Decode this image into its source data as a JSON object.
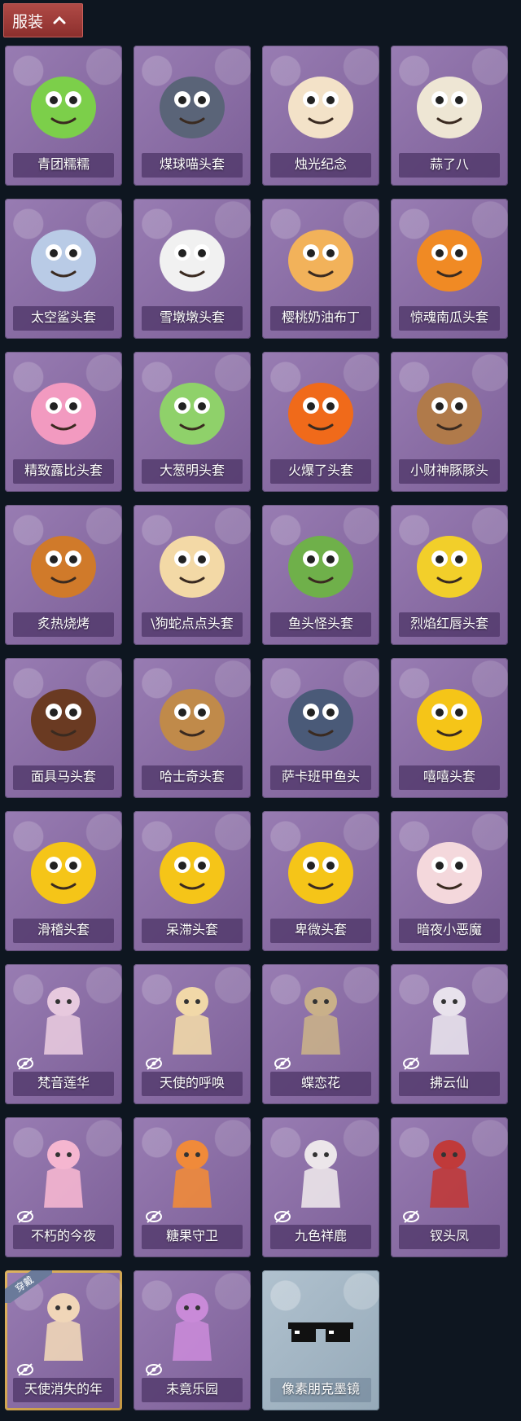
{
  "header": {
    "title": "服装"
  },
  "costumes": [
    {
      "label": "青团糯糯",
      "art": "green-mochi-head",
      "color": "#7ccf4a",
      "hidden": false
    },
    {
      "label": "煤球喵头套",
      "art": "gray-cat-head",
      "color": "#5a6478",
      "hidden": false
    },
    {
      "label": "烛光纪念",
      "art": "candle-head",
      "color": "#f3e2c8",
      "hidden": false
    },
    {
      "label": "蒜了八",
      "art": "garlic-head",
      "color": "#eee6d4",
      "hidden": false
    },
    {
      "label": "太空鲨头套",
      "art": "shark-head",
      "color": "#b9cbe6",
      "hidden": false
    },
    {
      "label": "雪墩墩头套",
      "art": "snowman-head",
      "color": "#f1f1f1",
      "hidden": false
    },
    {
      "label": "樱桃奶油布丁",
      "art": "pudding-head",
      "color": "#f2b25a",
      "hidden": false
    },
    {
      "label": "惊魂南瓜头套",
      "art": "pumpkin-head",
      "color": "#f08a24",
      "hidden": false
    },
    {
      "label": "精致露比头套",
      "art": "pink-beaver-head",
      "color": "#f29ac0",
      "hidden": false
    },
    {
      "label": "大葱明头套",
      "art": "scallion-head",
      "color": "#8fd16a",
      "hidden": false
    },
    {
      "label": "火爆了头套",
      "art": "fire-head",
      "color": "#f06a1a",
      "hidden": false
    },
    {
      "label": "小财神豚豚头",
      "art": "capybara-head",
      "color": "#b07a4a",
      "hidden": false
    },
    {
      "label": "炙热烧烤",
      "art": "bbq-head",
      "color": "#d07a2a",
      "hidden": false
    },
    {
      "label": "\\狗蛇点点头套",
      "art": "snake-dog-head",
      "color": "#f3d9a6",
      "hidden": false
    },
    {
      "label": "鱼头怪头套",
      "art": "fish-head",
      "color": "#6fb04a",
      "hidden": false
    },
    {
      "label": "烈焰红唇头套",
      "art": "pikachu-head",
      "color": "#f2cf2a",
      "hidden": false
    },
    {
      "label": "面具马头套",
      "art": "horse-head",
      "color": "#6a3a22",
      "hidden": false
    },
    {
      "label": "哈士奇头套",
      "art": "dog-sunglasses-head",
      "color": "#c08a4a",
      "hidden": false
    },
    {
      "label": "萨卡班甲鱼头",
      "art": "round-fish-head",
      "color": "#4a5a78",
      "hidden": false
    },
    {
      "label": "嘻嘻头套",
      "art": "grin-emoji-head",
      "color": "#f5c518",
      "hidden": false
    },
    {
      "label": "滑稽头套",
      "art": "smirk-emoji-head",
      "color": "#f5c518",
      "hidden": false
    },
    {
      "label": "呆滞头套",
      "art": "stare-emoji-head",
      "color": "#f5c518",
      "hidden": false
    },
    {
      "label": "卑微头套",
      "art": "humble-emoji-head",
      "color": "#f5c518",
      "hidden": false
    },
    {
      "label": "暗夜小恶魔",
      "art": "devil-mask",
      "color": "#f4d8dc",
      "hidden": false
    },
    {
      "label": "梵音莲华",
      "art": "lotus-figure",
      "color": "#e7c9de",
      "hidden": true
    },
    {
      "label": "天使的呼唤",
      "art": "angel-figure",
      "color": "#f1d8a8",
      "hidden": true
    },
    {
      "label": "蝶恋花",
      "art": "butterfly-ornament",
      "color": "#c9b089",
      "hidden": true
    },
    {
      "label": "拂云仙",
      "art": "cloud-fairy-ornament",
      "color": "#e8e2ec",
      "hidden": true
    },
    {
      "label": "不朽的今夜",
      "art": "pink-cat-bowl",
      "color": "#f5b6d0",
      "hidden": true
    },
    {
      "label": "糖果守卫",
      "art": "candy-guard-ornament",
      "color": "#f08a3a",
      "hidden": true
    },
    {
      "label": "九色祥鹿",
      "art": "deer-ornament",
      "color": "#ece6ea",
      "hidden": true
    },
    {
      "label": "钗头凤",
      "art": "phoenix-crown-figure",
      "color": "#c03a3a",
      "hidden": true
    },
    {
      "label": "天使消失的年",
      "art": "angel-girl-figure",
      "color": "#f0d6b8",
      "hidden": true,
      "worn": true,
      "worn_label": "穿戴"
    },
    {
      "label": "未竟乐园",
      "art": "jester-girl-figure",
      "color": "#c98ad8",
      "hidden": true
    },
    {
      "label": "像素朋克墨镜",
      "art": "pixel-sunglasses",
      "color": "#111111",
      "hidden": false,
      "tint": "blue"
    }
  ]
}
